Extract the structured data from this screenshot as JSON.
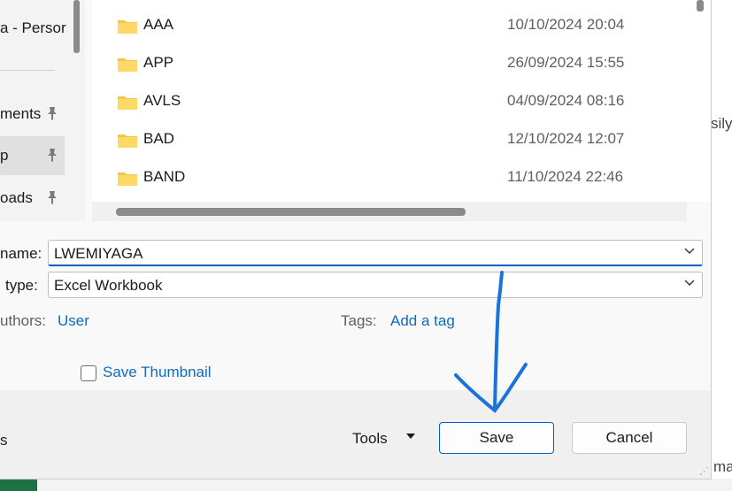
{
  "background": {
    "right_text_1": "sily",
    "right_text_2": "ma"
  },
  "nav": {
    "top_label": "a - Persor",
    "items": [
      {
        "label": "ments",
        "pinned": true
      },
      {
        "label": "p",
        "pinned": true,
        "selected": true
      },
      {
        "label": "oads",
        "pinned": true
      }
    ],
    "pin_icon": "📌"
  },
  "files": [
    {
      "name": "AAA",
      "date": "10/10/2024 20:04"
    },
    {
      "name": "APP",
      "date": "26/09/2024 15:55"
    },
    {
      "name": "AVLS",
      "date": "04/09/2024 08:16"
    },
    {
      "name": "BAD",
      "date": "12/10/2024 12:07"
    },
    {
      "name": "BAND",
      "date": "11/10/2024 22:46"
    }
  ],
  "form": {
    "filename_label": "name:",
    "filename_value": "LWEMIYAGA",
    "filetype_label": "type:",
    "filetype_value": "Excel Workbook",
    "authors_label": "uthors:",
    "authors_value": "User",
    "tags_label": "Tags:",
    "tags_value": "Add a tag",
    "thumbnail_label": "Save Thumbnail",
    "thumbnail_checked": false
  },
  "footer": {
    "left_text": "s",
    "tools_label": "Tools",
    "save_label": "Save",
    "cancel_label": "Cancel"
  },
  "colors": {
    "accent": "#005fb8",
    "link": "#0f6cbd",
    "annotation_arrow": "#1a73d9",
    "folder": "#f4c542"
  }
}
